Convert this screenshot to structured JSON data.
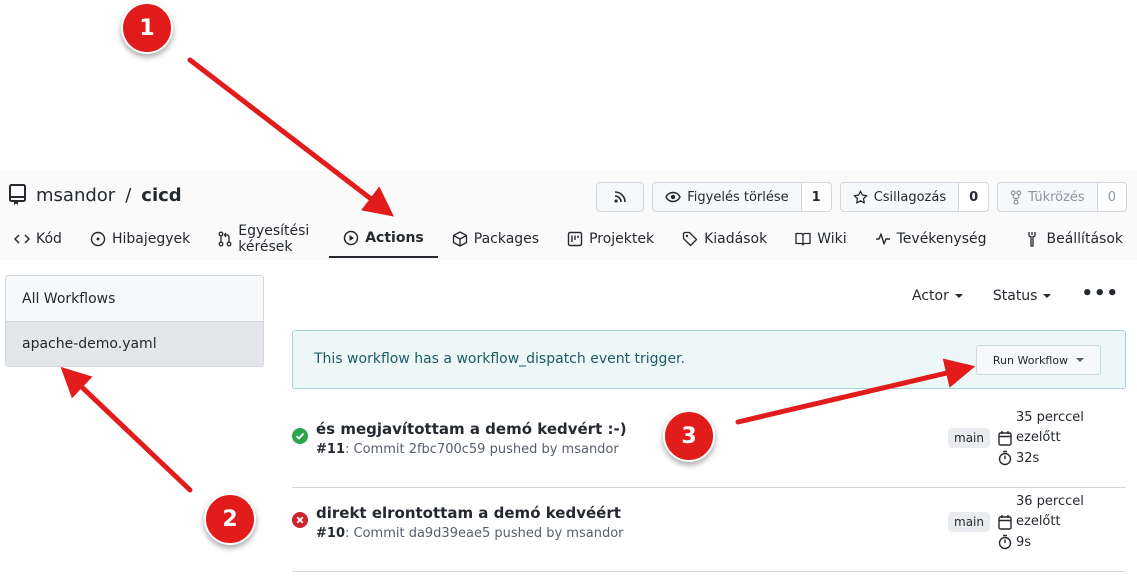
{
  "repo": {
    "owner": "msandor",
    "separator": "/",
    "name": "cicd"
  },
  "header_buttons": {
    "watch": {
      "label": "Figyelés törlése",
      "count": "1"
    },
    "star": {
      "label": "Csillagozás",
      "count": "0"
    },
    "fork": {
      "label": "Tükrözés",
      "count": "0"
    }
  },
  "tabs": [
    {
      "label": "Kód",
      "icon": "code-icon"
    },
    {
      "label": "Hibajegyek",
      "icon": "issue-icon"
    },
    {
      "label": "Egyesítési kérések",
      "icon": "pull-request-icon"
    },
    {
      "label": "Actions",
      "icon": "play-icon",
      "active": true
    },
    {
      "label": "Packages",
      "icon": "package-icon"
    },
    {
      "label": "Projektek",
      "icon": "project-icon"
    },
    {
      "label": "Kiadások",
      "icon": "tag-icon"
    },
    {
      "label": "Wiki",
      "icon": "book-icon"
    },
    {
      "label": "Tevékenység",
      "icon": "pulse-icon"
    },
    {
      "label": "Beállítások",
      "icon": "tools-icon"
    }
  ],
  "sidebar": {
    "items": [
      {
        "label": "All Workflows"
      },
      {
        "label": "apache-demo.yaml",
        "active": true
      }
    ]
  },
  "filters": {
    "actor": "Actor",
    "status": "Status",
    "more": "•••"
  },
  "dispatch": {
    "message": "This workflow has a workflow_dispatch event trigger.",
    "button": "Run Workflow"
  },
  "runs": [
    {
      "status": "success",
      "title": "és megjavítottam a demó kedvért :-)",
      "number": "#11",
      "detail": ": Commit 2fbc700c59 pushed by msandor",
      "branch": "main",
      "time_line1": "35 perccel",
      "time_line2": "ezelőtt",
      "duration": "32s"
    },
    {
      "status": "failure",
      "title": "direkt elrontottam a demó kedvéért",
      "number": "#10",
      "detail": ": Commit da9d39eae5 pushed by msandor",
      "branch": "main",
      "time_line1": "36 perccel",
      "time_line2": "ezelőtt",
      "duration": "9s"
    }
  ],
  "callouts": [
    "1",
    "2",
    "3"
  ],
  "colors": {
    "callout": "#e21b1b",
    "success": "#2da44e",
    "failure": "#cf222e",
    "dispatch_bg": "#eef7f7"
  }
}
